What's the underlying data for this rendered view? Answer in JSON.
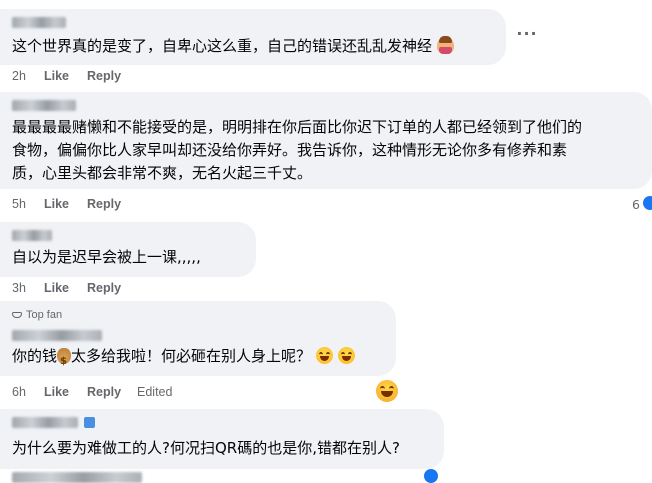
{
  "comments": [
    {
      "text_lines": [
        "这个世界真的是变了，自卑心这么重，自己的错误还乱乱发神经"
      ],
      "emoji": "woman-gesturing-icon",
      "actions": {
        "time": "2h",
        "like": "Like",
        "reply": "Reply"
      },
      "more": "···"
    },
    {
      "text_lines": [
        "最最最最赌懒和不能接受的是，明明排在你后面比你迟下订单的人都已经领到了他们的",
        "食物，偏偏你比人家早叫却还没给你弄好。我告诉你，这种情形无论你多有修养和素",
        "质，心里头都会非常不爽，无名火起三千丈。"
      ],
      "actions": {
        "time": "5h",
        "like": "Like",
        "reply": "Reply"
      },
      "reaction_count": "6"
    },
    {
      "text_lines": [
        "自以为是迟早会被上一课,,,,,"
      ],
      "actions": {
        "time": "3h",
        "like": "Like",
        "reply": "Reply"
      }
    },
    {
      "badge": "Top fan",
      "text_before": "你的钱",
      "text_after": "太多给我啦！何必砸在别人身上呢？",
      "actions": {
        "time": "6h",
        "like": "Like",
        "reply": "Reply",
        "edited": "Edited"
      }
    },
    {
      "text_lines": [
        "为什么要为难做工的人?何况扫QR碼的也是你,错都在别人?"
      ]
    }
  ],
  "colors": {
    "bubble": "#f0f2f5",
    "meta": "#65676b",
    "text": "#050505"
  }
}
